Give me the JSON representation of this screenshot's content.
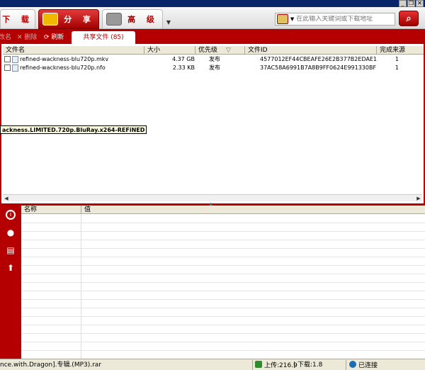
{
  "tabs": [
    {
      "label": "下 载"
    },
    {
      "label": "分 享"
    },
    {
      "label": "高 级"
    }
  ],
  "search": {
    "placeholder": "在此输入关键词或下载地址"
  },
  "actions": {
    "rename": "改名",
    "delete": "删除",
    "refresh": "刷新"
  },
  "share_tab": {
    "label": "共享文件 (85)"
  },
  "columns": [
    "文件名",
    "大小",
    "优先级",
    "文件ID",
    "完成来源"
  ],
  "files": [
    {
      "name": "refined-wackness-blu720p.mkv",
      "size": "4.37 GB",
      "priority": "发布",
      "id": "4577012EF44CBEAFE26E2B377B2EDAE1",
      "sources": "1"
    },
    {
      "name": "refined-wackness-blu720p.nfo",
      "size": "2.33 KB",
      "priority": "发布",
      "id": "37AC58A6991B7A8B9FF0624E991330BF",
      "sources": "1"
    }
  ],
  "tooltip": "ackness.LIMITED.720p.BluRay.x264-REFiNED",
  "detail_columns": [
    "名称",
    "值"
  ],
  "status": {
    "file": "nce.with.Dragon].专辑.(MP3).rar",
    "upload": "上传:216.9",
    "download": "下载:1.8",
    "connection": "已连接"
  },
  "colors": {
    "accent": "#b40000"
  },
  "icons": [
    "info-icon",
    "chat-icon",
    "list-icon",
    "upload-icon"
  ]
}
